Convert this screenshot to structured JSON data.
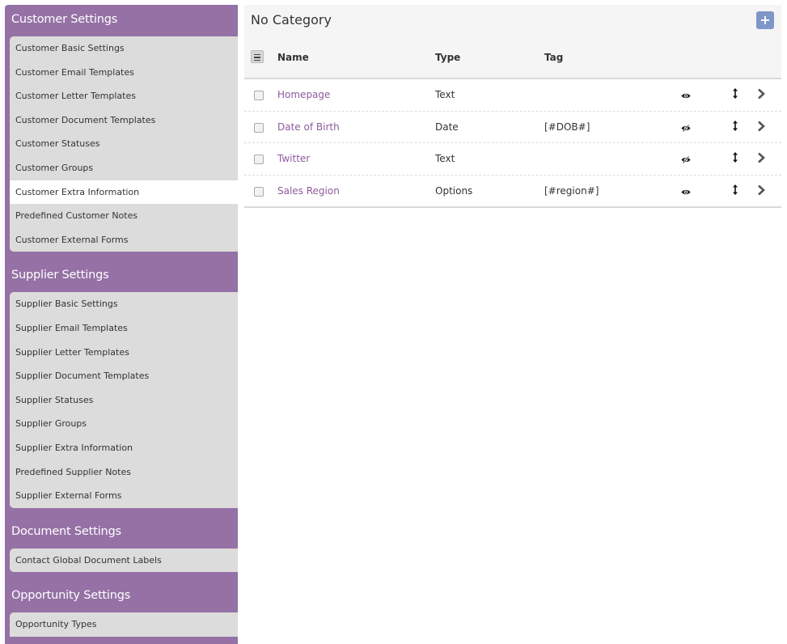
{
  "sidebar": {
    "sections": [
      {
        "title": "Customer Settings",
        "items": [
          "Customer Basic Settings",
          "Customer Email Templates",
          "Customer Letter Templates",
          "Customer Document Templates",
          "Customer Statuses",
          "Customer Groups",
          "Customer Extra Information",
          "Predefined Customer Notes",
          "Customer External Forms"
        ],
        "active_item": "Customer Extra Information"
      },
      {
        "title": "Supplier Settings",
        "items": [
          "Supplier Basic Settings",
          "Supplier Email Templates",
          "Supplier Letter Templates",
          "Supplier Document Templates",
          "Supplier Statuses",
          "Supplier Groups",
          "Supplier Extra Information",
          "Predefined Supplier Notes",
          "Supplier External Forms"
        ]
      },
      {
        "title": "Document Settings",
        "items": [
          "Contact Global Document Labels"
        ]
      },
      {
        "title": "Opportunity Settings",
        "items": [
          "Opportunity Types"
        ]
      }
    ]
  },
  "panel": {
    "title": "No Category",
    "add_icon": "plus-icon",
    "columns": {
      "name": "Name",
      "type": "Type",
      "tag": "Tag"
    },
    "rows": [
      {
        "name": "Homepage",
        "type": "Text",
        "tag": "",
        "visibility": "visible"
      },
      {
        "name": "Date of Birth",
        "type": "Date",
        "tag": "[#DOB#]",
        "visibility": "hidden"
      },
      {
        "name": "Twitter",
        "type": "Text",
        "tag": "",
        "visibility": "hidden"
      },
      {
        "name": "Sales Region",
        "type": "Options",
        "tag": "[#region#]",
        "visibility": "visible"
      }
    ]
  },
  "colors": {
    "sidebar_bg": "#9571a5",
    "link": "#8d5b9e",
    "add_button": "#7e97c6"
  }
}
